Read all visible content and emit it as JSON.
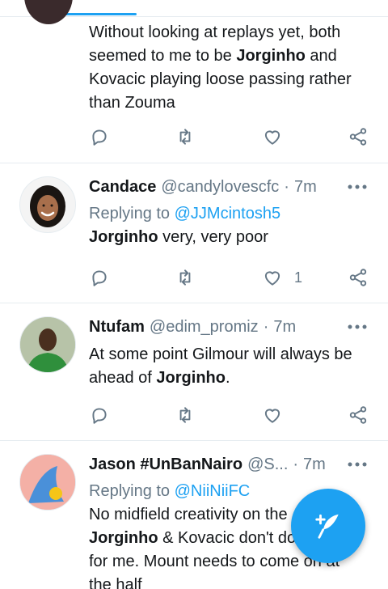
{
  "tweets": [
    {
      "text_parts": [
        "Without looking at replays yet, both",
        "seemed to me to be ",
        "Jorginho",
        " and",
        "Kovacic playing loose passing rather",
        "than Zouma"
      ]
    },
    {
      "name": "Candace",
      "handle": "@candylovescfc",
      "dot": "·",
      "time": "7m",
      "replying_label": "Replying to",
      "replying_to": "@JJMcintosh5",
      "text_bold": "Jorginho",
      "text_rest": " very, very poor",
      "like_count": "1"
    },
    {
      "name": "Ntufam",
      "handle": "@edim_promiz",
      "dot": "·",
      "time": "7m",
      "text_parts": [
        "At some point Gilmour will always be",
        "ahead of ",
        "Jorginho",
        "."
      ]
    },
    {
      "name": "Jason #UnBanNairo",
      "handle": "@S...",
      "dot": "·",
      "time": "7m",
      "replying_label": "Replying to",
      "replying_to": "@NiiNiiFC",
      "text_parts": [
        "No midfield creativity on the",
        "Jorginho",
        " & Kovacic don't do",
        "for me. Mount needs to come on at",
        "the half"
      ]
    }
  ],
  "icons": {
    "reply": "reply-icon",
    "retweet": "retweet-icon",
    "like": "heart-icon",
    "share": "share-icon",
    "more": "more-options-icon",
    "compose": "compose-tweet-icon"
  },
  "colors": {
    "accent": "#1da1f2",
    "secondary_text": "#657786",
    "icon_gray": "#657786",
    "divider": "#e6ecf0"
  }
}
